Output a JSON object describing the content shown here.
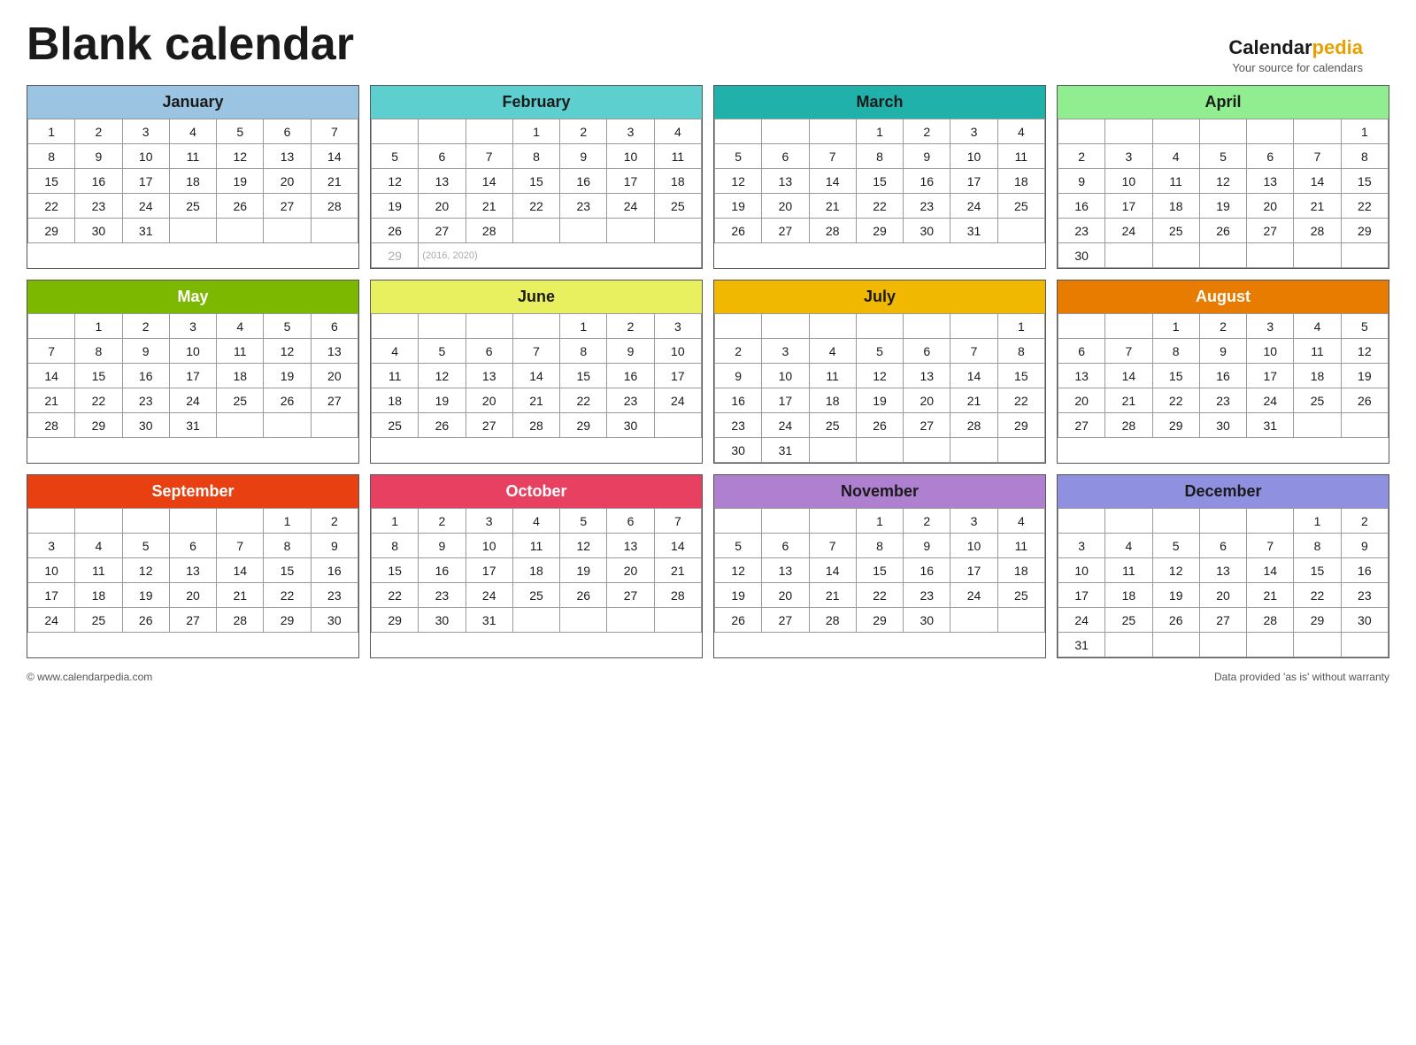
{
  "title": "Blank calendar",
  "logo": {
    "calendar": "Calendar",
    "pedia": "pedia",
    "subtitle": "Your source for calendars"
  },
  "footer": {
    "left": "© www.calendarpedia.com",
    "right": "Data provided 'as is' without warranty"
  },
  "months": [
    {
      "name": "January",
      "headerClass": "jan-header",
      "days": 31,
      "startDay": 0,
      "leapNote": null
    },
    {
      "name": "February",
      "headerClass": "feb-header",
      "days": 28,
      "startDay": 3,
      "leapNote": "(2016, 2020)"
    },
    {
      "name": "March",
      "headerClass": "mar-header",
      "days": 31,
      "startDay": 3,
      "leapNote": null
    },
    {
      "name": "April",
      "headerClass": "apr-header",
      "days": 30,
      "startDay": 6,
      "leapNote": null
    },
    {
      "name": "May",
      "headerClass": "may-header",
      "days": 31,
      "startDay": 1,
      "leapNote": null
    },
    {
      "name": "June",
      "headerClass": "jun-header",
      "days": 30,
      "startDay": 4,
      "leapNote": null
    },
    {
      "name": "July",
      "headerClass": "jul-header",
      "days": 31,
      "startDay": 6,
      "leapNote": null
    },
    {
      "name": "August",
      "headerClass": "aug-header",
      "days": 31,
      "startDay": 2,
      "leapNote": null
    },
    {
      "name": "September",
      "headerClass": "sep-header",
      "days": 30,
      "startDay": 5,
      "leapNote": null
    },
    {
      "name": "October",
      "headerClass": "oct-header",
      "days": 31,
      "startDay": 0,
      "leapNote": null
    },
    {
      "name": "November",
      "headerClass": "nov-header",
      "days": 30,
      "startDay": 3,
      "leapNote": null
    },
    {
      "name": "December",
      "headerClass": "dec-header",
      "days": 31,
      "startDay": 5,
      "leapNote": null
    }
  ]
}
